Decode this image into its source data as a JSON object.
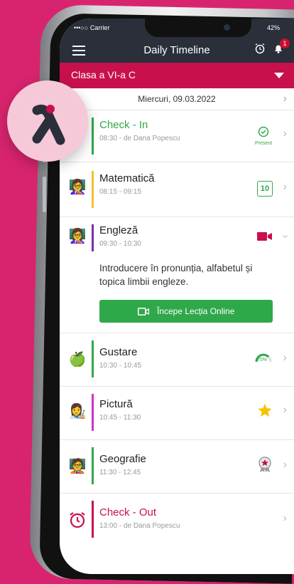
{
  "status": {
    "carrier": "•••○○ Carrier",
    "battery": "42%"
  },
  "nav": {
    "title": "Daily Timeline",
    "badge": "1"
  },
  "class_selector": {
    "label": "Clasa a VI-a C"
  },
  "date": {
    "label": "Miercuri, 09.03.2022"
  },
  "rows": [
    {
      "title": "Check - In",
      "time": "08:30 - de Dana Popescu",
      "color": "#2fa84a",
      "title_color": "#2fa84a",
      "status": "Present"
    },
    {
      "title": "Matematică",
      "time": "08:15 - 09:15",
      "color": "#f2c12e",
      "grade": "10"
    },
    {
      "title": "Engleză",
      "time": "09:30 - 10:30",
      "color": "#7b2fa6",
      "description": "Introducere în pronunția, alfabetul și topica limbii engleze.",
      "button": "Începe Lecția Online"
    },
    {
      "title": "Gustare",
      "time": "10:30 - 10:45",
      "color": "#2fa84a",
      "progress": "75%",
      "progress_value": 0.75
    },
    {
      "title": "Pictură",
      "time": "10:45 - 11:30",
      "color": "#cc33cc"
    },
    {
      "title": "Geografie",
      "time": "11:30 - 12:45",
      "color": "#2fa84a"
    },
    {
      "title": "Check - Out",
      "time": "13:00 - de Dana Popescu",
      "color": "#c8104c",
      "title_color": "#c8104c"
    }
  ],
  "colors": {
    "background": "#d8246e",
    "accent": "#c8104c",
    "green": "#2fa84a",
    "nav": "#2a2f3a"
  }
}
